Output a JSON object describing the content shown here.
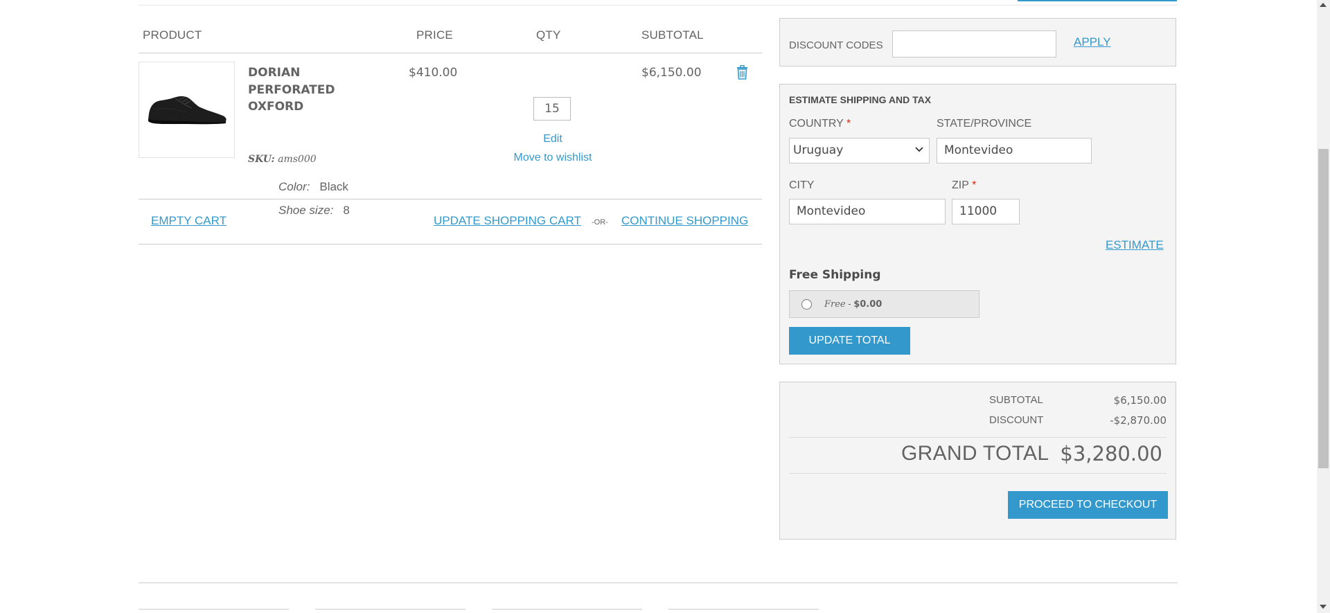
{
  "cart": {
    "headers": {
      "product": "PRODUCT",
      "price": "PRICE",
      "qty": "QTY",
      "subtotal": "SUBTOTAL"
    },
    "item": {
      "name": "DORIAN PERFORATED OXFORD",
      "sku_label": "SKU:",
      "sku": "ams000",
      "options": [
        {
          "label": "Color:",
          "value": "Black"
        },
        {
          "label": "Shoe size:",
          "value": "8"
        }
      ],
      "price": "$410.00",
      "qty": "15",
      "edit": "Edit",
      "wishlist": "Move to wishlist",
      "subtotal": "$6,150.00",
      "remove_icon": "trash-icon"
    },
    "actions": {
      "empty": "EMPTY CART",
      "update": "UPDATE SHOPPING CART",
      "or": "-OR-",
      "continue": "CONTINUE SHOPPING"
    }
  },
  "discount": {
    "label": "DISCOUNT CODES",
    "value": "",
    "apply": "APPLY"
  },
  "shipping": {
    "title": "ESTIMATE SHIPPING AND TAX",
    "country_label": "COUNTRY",
    "country": "Uruguay",
    "state_label": "STATE/PROVINCE",
    "state": "Montevideo",
    "city_label": "CITY",
    "city": "Montevideo",
    "zip_label": "ZIP",
    "zip": "11000",
    "required_mark": "*",
    "estimate": "ESTIMATE",
    "method_title": "Free Shipping",
    "option_name": "Free",
    "option_sep": " - ",
    "option_price": "$0.00",
    "update_total": "UPDATE TOTAL"
  },
  "totals": {
    "subtotal_label": "SUBTOTAL",
    "subtotal": "$6,150.00",
    "discount_label": "DISCOUNT",
    "discount": "-$2,870.00",
    "grand_label": "GRAND TOTAL",
    "grand": "$3,280.00",
    "checkout": "PROCEED TO CHECKOUT"
  },
  "colors": {
    "accent": "#3399cc",
    "text": "#636363",
    "panel": "#f4f4f4",
    "required": "#df280a"
  }
}
